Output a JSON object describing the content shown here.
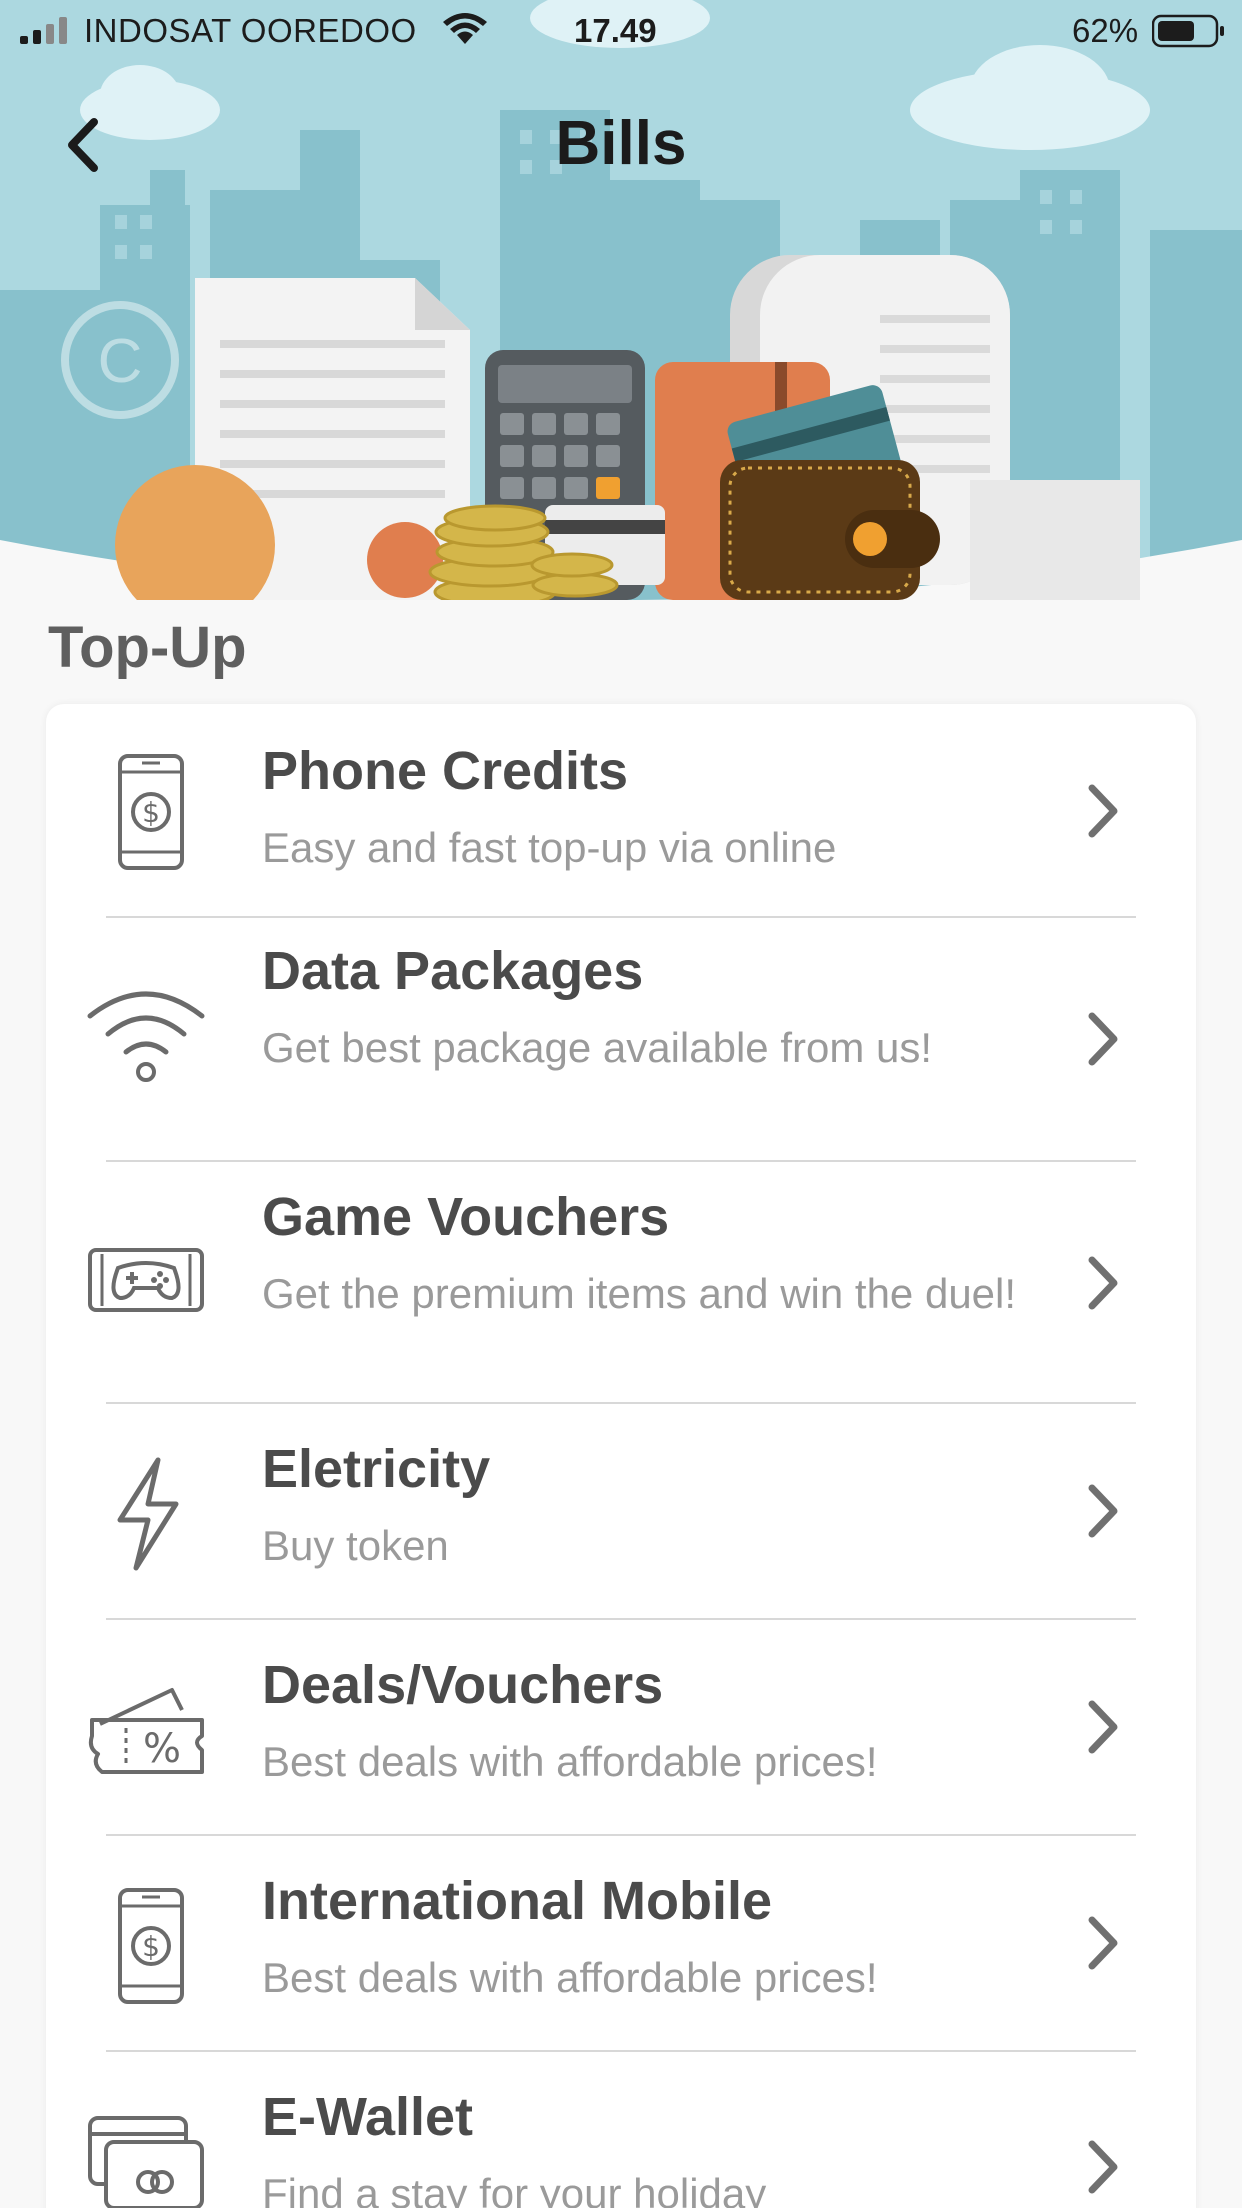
{
  "status_bar": {
    "carrier": "INDOSAT OOREDOO",
    "time": "17.49",
    "battery_percent": "62%"
  },
  "header": {
    "title": "Bills",
    "back_icon": "chevron-left-icon"
  },
  "section": {
    "title": "Top-Up"
  },
  "items": [
    {
      "title": "Phone Credits",
      "subtitle": "Easy and fast top-up via online",
      "icon": "phone-dollar-icon"
    },
    {
      "title": "Data Packages",
      "subtitle": "Get best package available from us!",
      "icon": "wifi-icon"
    },
    {
      "title": "Game Vouchers",
      "subtitle": "Get the premium items and win the duel!",
      "icon": "gamepad-icon"
    },
    {
      "title": "Eletricity",
      "subtitle": "Buy token",
      "icon": "lightning-icon"
    },
    {
      "title": "Deals/Vouchers",
      "subtitle": "Best deals with affordable prices!",
      "icon": "voucher-percent-icon"
    },
    {
      "title": "International Mobile",
      "subtitle": "Best deals with affordable prices!",
      "icon": "phone-dollar-icon"
    },
    {
      "title": "E-Wallet",
      "subtitle": "Find a stay for your holiday",
      "icon": "wallet-card-icon"
    }
  ],
  "colors": {
    "sky": "#acd8e0",
    "background": "#f8f8f8",
    "title_text": "#4b4b4b",
    "subtitle_text": "#9a9a9a"
  }
}
